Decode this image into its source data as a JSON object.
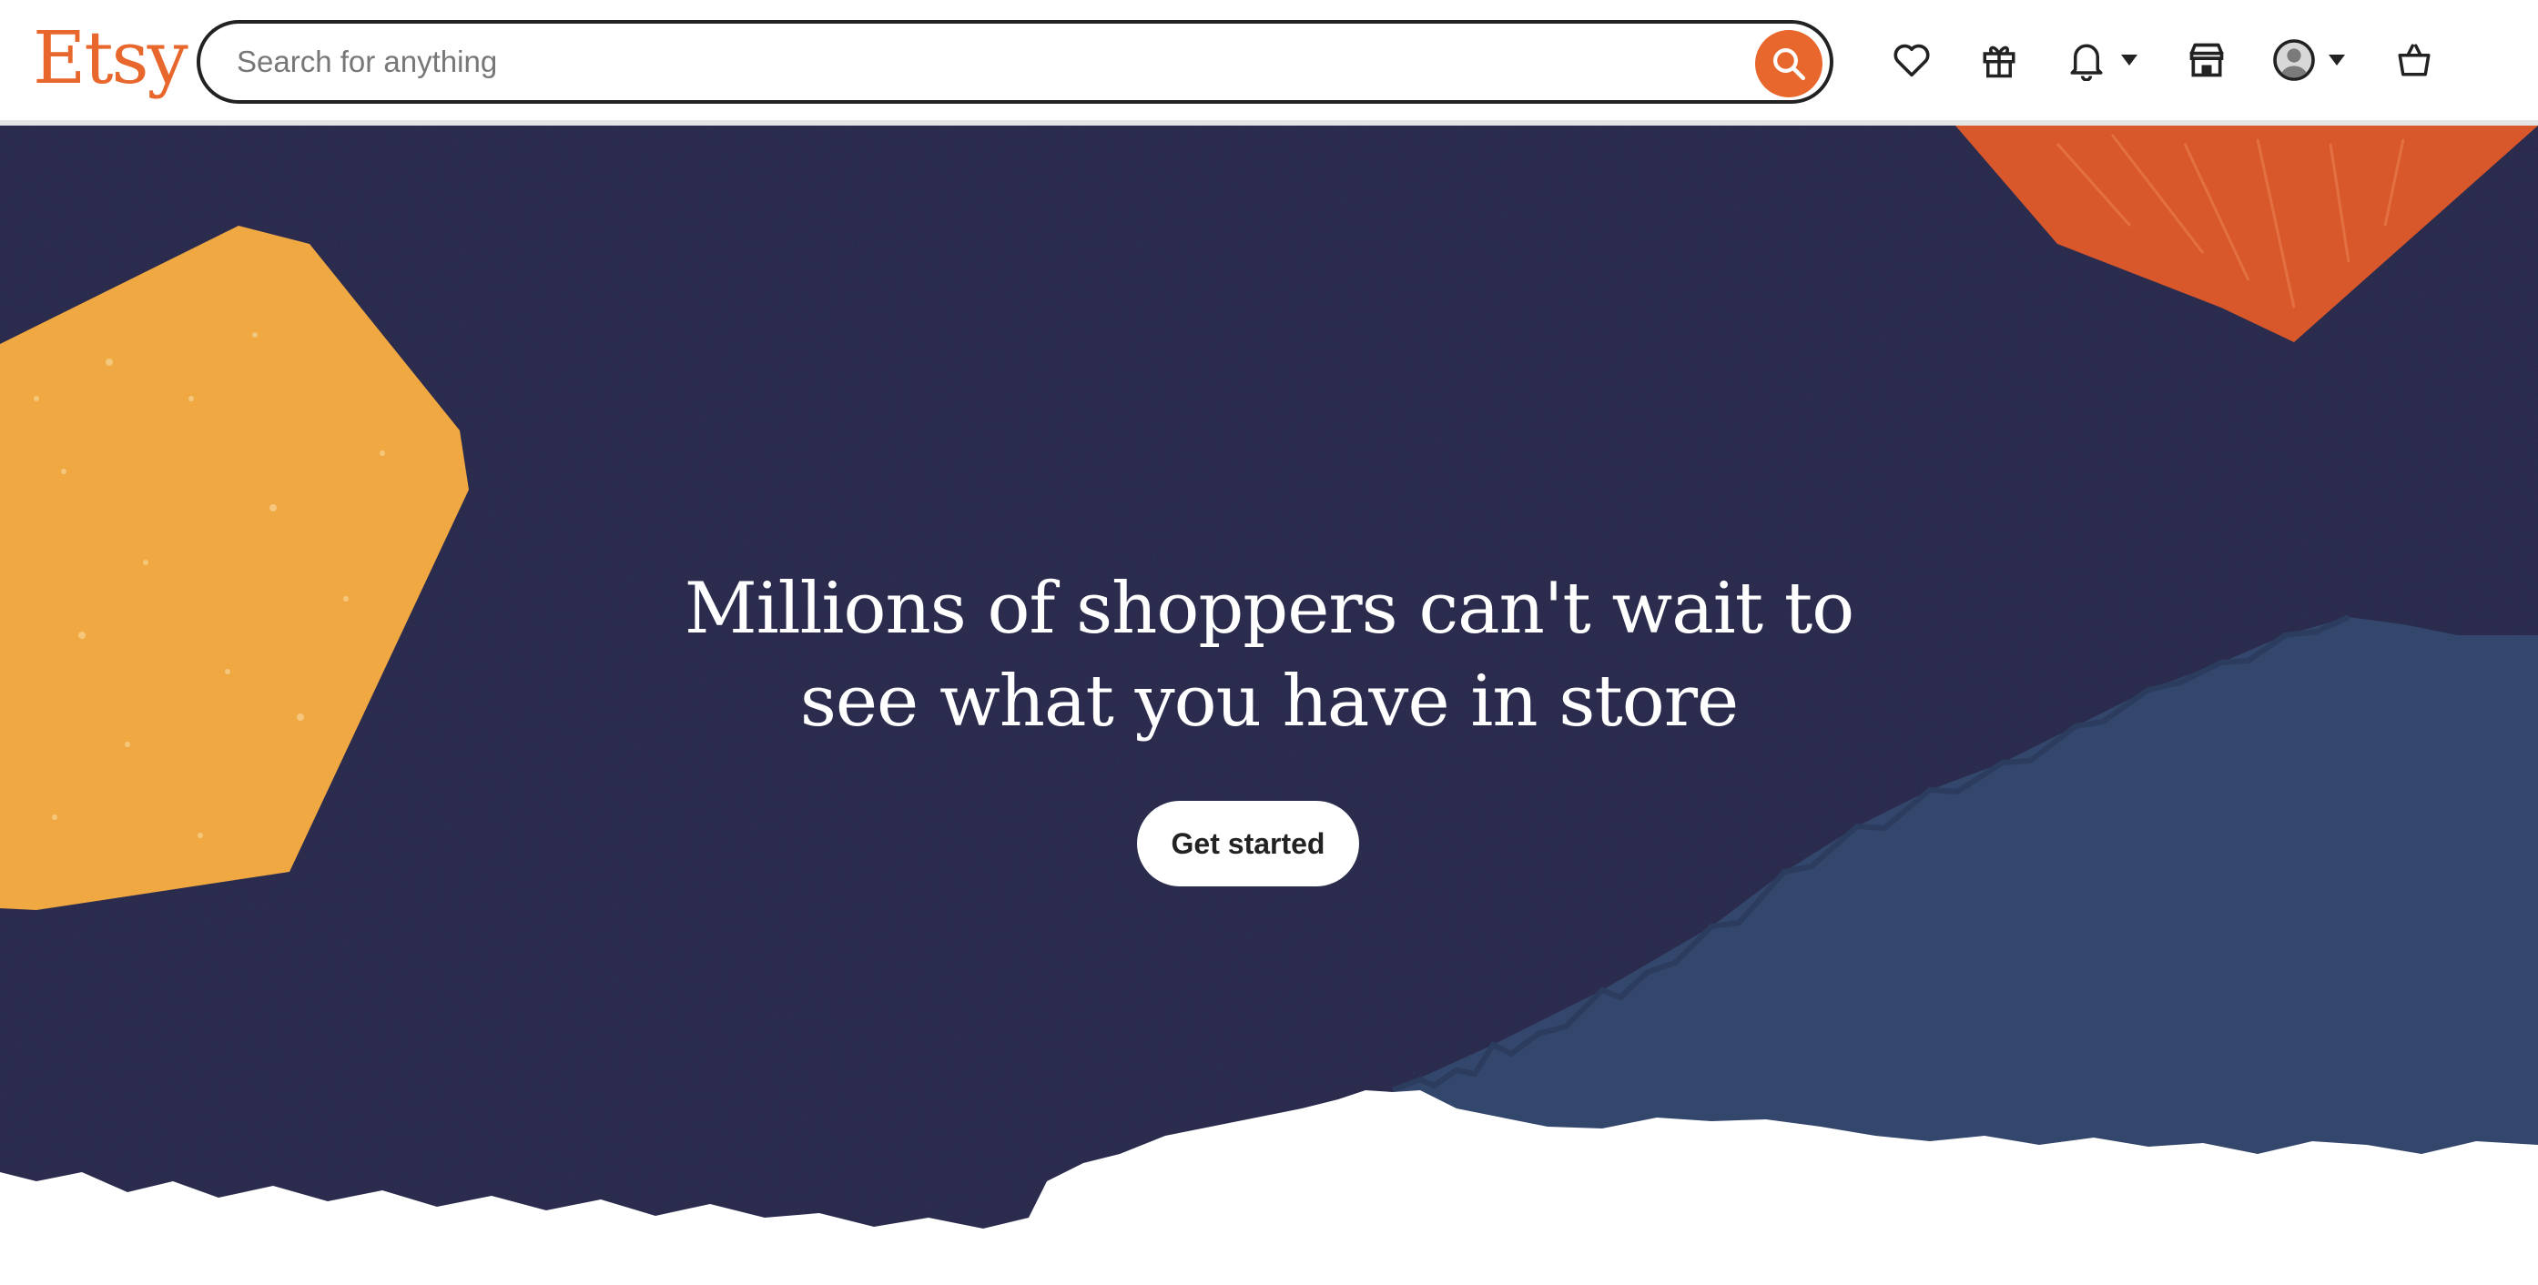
{
  "brand": {
    "logo_text": "Etsy",
    "accent_color": "#e8672c"
  },
  "search": {
    "placeholder": "Search for anything",
    "value": ""
  },
  "header_icons": [
    {
      "name": "favorites-icon"
    },
    {
      "name": "gift-icon"
    },
    {
      "name": "notifications-icon",
      "has_dropdown": true
    },
    {
      "name": "shop-manager-icon"
    },
    {
      "name": "account-avatar-icon",
      "has_dropdown": true
    },
    {
      "name": "cart-icon"
    }
  ],
  "hero": {
    "headline_line1": "Millions of shoppers can't wait to",
    "headline_line2": "see what you have in store",
    "cta_label": "Get started",
    "colors": {
      "background": "#252649",
      "yellow_shape": "#f0a843",
      "orange_shape": "#d9582b",
      "blue_shape": "#33466b"
    }
  }
}
